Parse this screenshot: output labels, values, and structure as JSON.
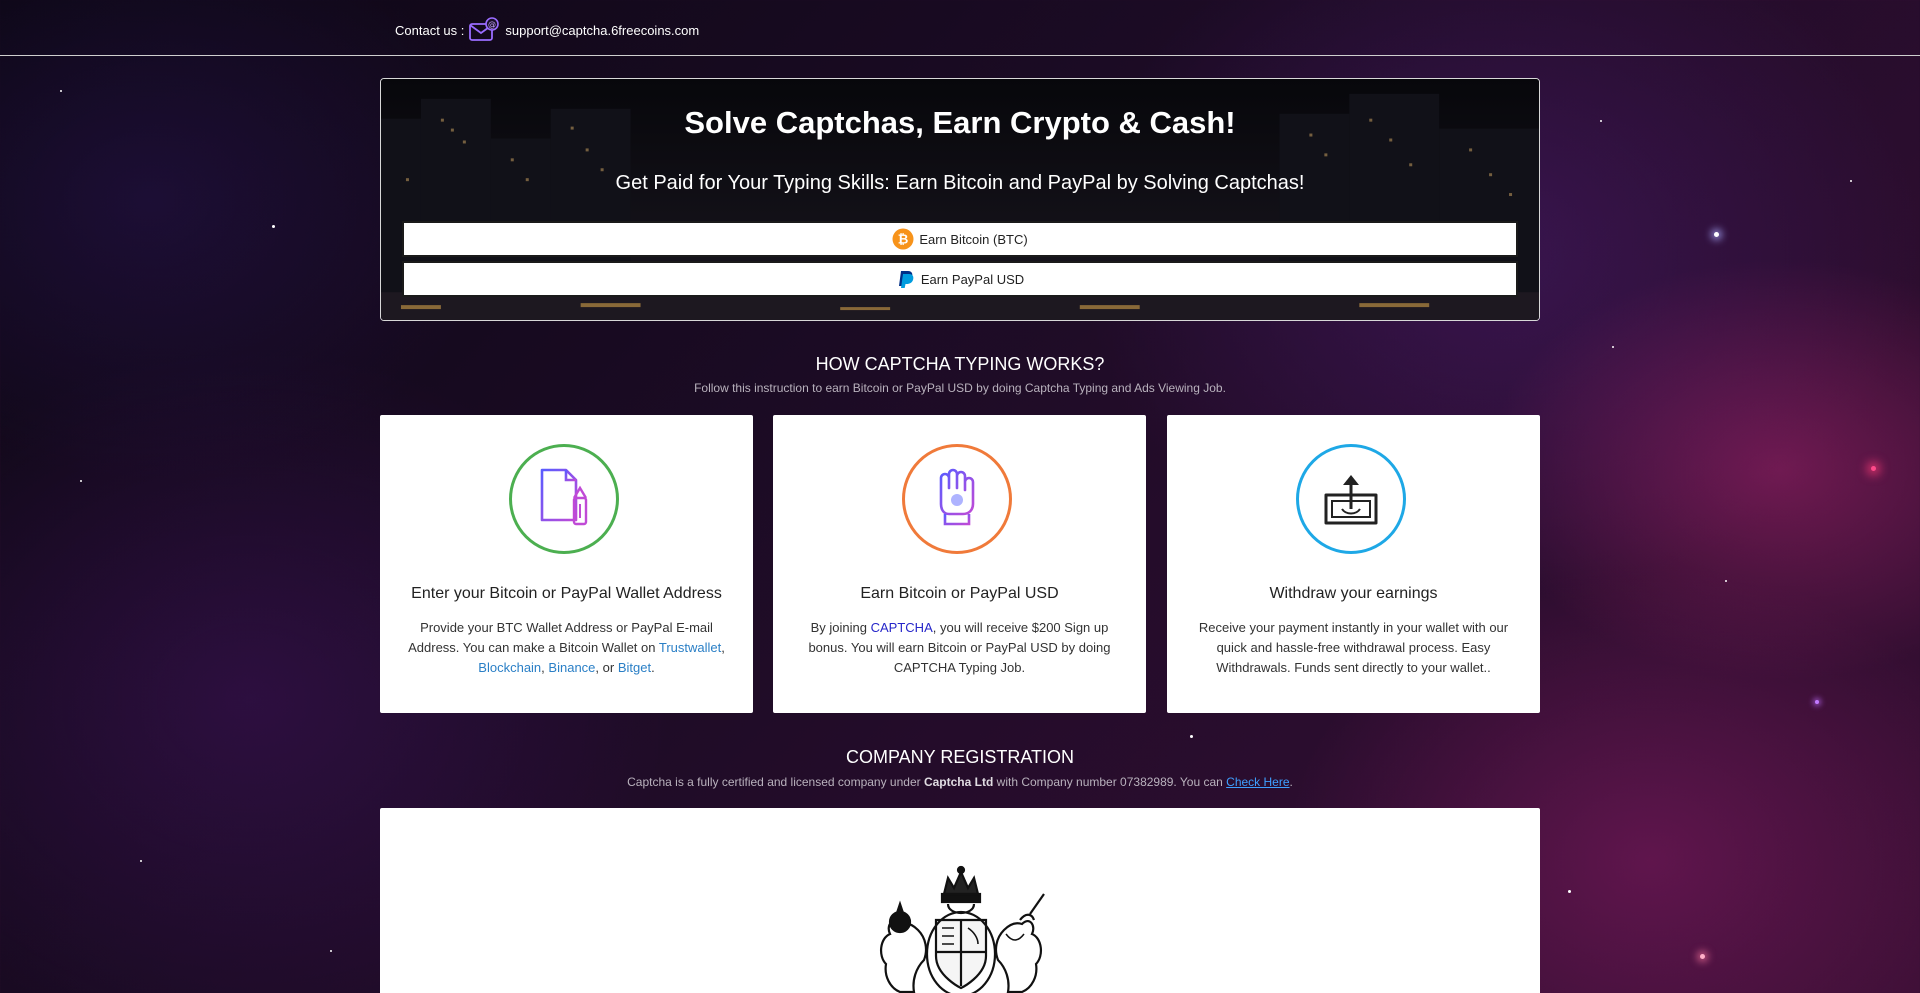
{
  "topbar": {
    "contact_label": "Contact us :",
    "email": "support@captcha.6freecoins.com",
    "icon": "envelope-icon"
  },
  "hero": {
    "title": "Solve Captchas, Earn Crypto & Cash!",
    "subtitle": "Get Paid for Your Typing Skills: Earn Bitcoin and PayPal by Solving Captchas!",
    "btc_button": "Earn Bitcoin (BTC)",
    "paypal_button": "Earn PayPal USD"
  },
  "how": {
    "title": "HOW CAPTCHA TYPING WORKS?",
    "subtitle": "Follow this instruction to earn Bitcoin or PayPal USD by doing Captcha Typing and Ads Viewing Job.",
    "cards": [
      {
        "title": "Enter your Bitcoin or PayPal Wallet Address",
        "text_before": "Provide your BTC Wallet Address or PayPal E-mail Address. You can make a Bitcoin Wallet on",
        "links": [
          "Trustwallet",
          "Blockchain",
          "Binance",
          "Bitget"
        ],
        "sep1": ",",
        "sep2": ",",
        "sep3": ", or",
        "end": ".",
        "icon": "document-pencil-icon",
        "color": "#4caf50"
      },
      {
        "title": "Earn Bitcoin or PayPal USD",
        "text_before": "By joining",
        "brand": "CAPTCHA",
        "text_after": ", you will receive $200 Sign up bonus. You will earn Bitcoin or PayPal USD by doing CAPTCHA Typing Job.",
        "icon": "hand-coin-icon",
        "color": "#f07a3a"
      },
      {
        "title": "Withdraw your earnings",
        "text": "Receive your payment instantly in your wallet with our quick and hassle-free withdrawal process. Easy Withdrawals. Funds sent directly to your wallet..",
        "icon": "cash-upload-icon",
        "color": "#1ea8e6"
      }
    ]
  },
  "registration": {
    "title": "COMPANY REGISTRATION",
    "text_before": "Captcha is a fully certified and licensed company under",
    "company": "Captcha Ltd",
    "text_middle": "with Company number 07382989. You can",
    "link": "Check Here",
    "end": ".",
    "image": "royal-coat-of-arms"
  }
}
